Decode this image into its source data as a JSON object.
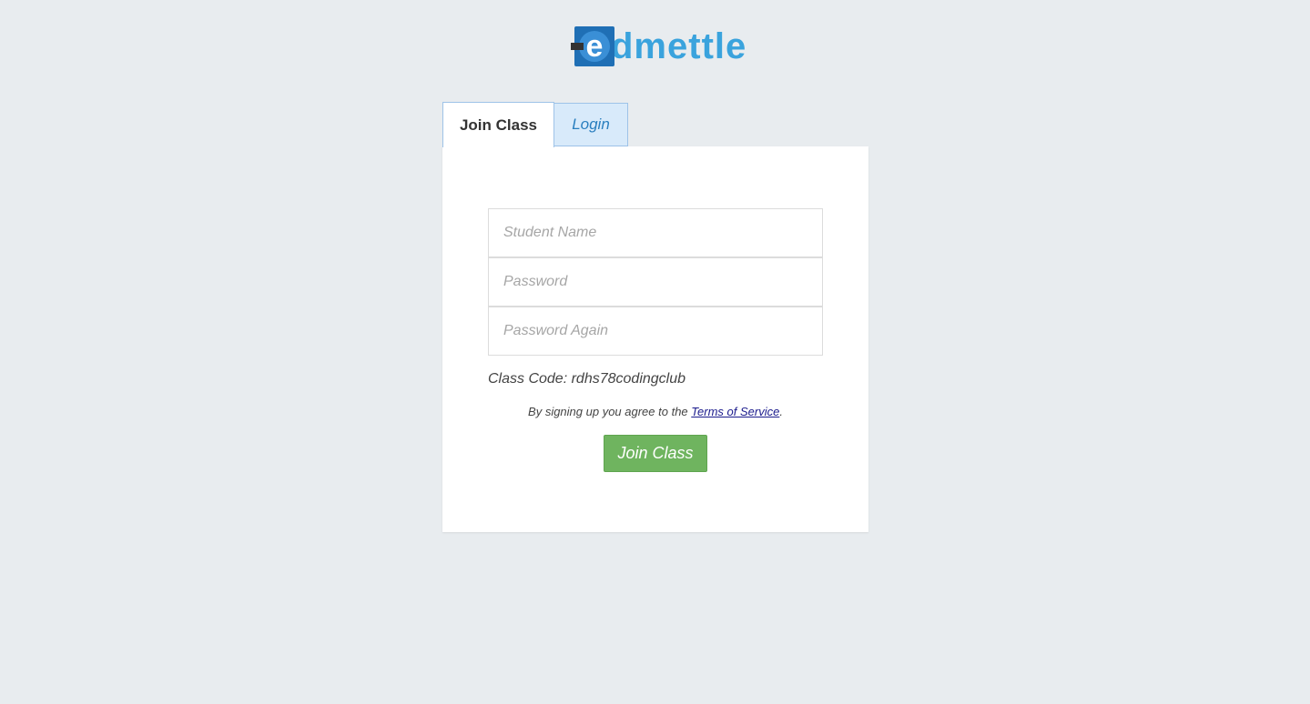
{
  "logo": {
    "mark_letter": "e",
    "text": "dmettle",
    "colors": {
      "mark": "#1f6fb5",
      "text": "#3aa3dd"
    }
  },
  "tabs": [
    {
      "label": "Join Class",
      "active": true
    },
    {
      "label": "Login",
      "active": false
    }
  ],
  "form": {
    "student_name_placeholder": "Student Name",
    "password_placeholder": "Password",
    "password_again_placeholder": "Password Again",
    "class_code_text": "Class Code: rdhs78codingclub",
    "terms_prefix": "By signing up you agree to the ",
    "terms_link": "Terms of Service",
    "terms_suffix": ".",
    "submit_label": "Join Class"
  },
  "colors": {
    "background": "#e8ecef",
    "button": "#6fb45f",
    "tab_inactive": "#d8eafa"
  }
}
